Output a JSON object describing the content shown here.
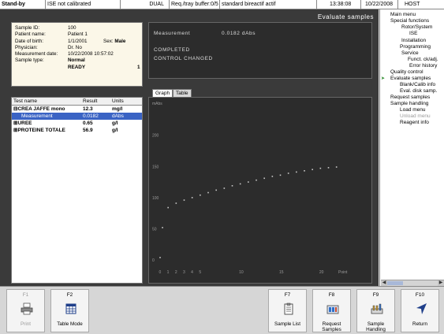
{
  "status_bar": {
    "state": "Stand-by",
    "ise_status": "ISE not calibrated",
    "mode": "DUAL",
    "tray_request": "Req./tray buffer:0/5",
    "bireactif": "standard bireactif actif",
    "time": "13:38:08",
    "date": "10/22/2008",
    "host": "HOST"
  },
  "screen_title": "Evaluate samples",
  "sample_info": {
    "sample_id_label": "Sample ID:",
    "sample_id": "100",
    "patient_name_label": "Patient name:",
    "patient_name": "Patient 1",
    "dob_label": "Date of birth:",
    "dob": "1/1/2001",
    "sex_label": "Sex:",
    "sex": "Male",
    "physician_label": "Physician:",
    "physician": "Dr. No",
    "meas_date_label": "Measurement date:",
    "meas_date": "10/22/2008 10:57:02",
    "sample_type_label": "Sample type:",
    "sample_type": "Normal",
    "state": "READY",
    "count": "1"
  },
  "results_table": {
    "headers": {
      "name": "Test name",
      "result": "Result",
      "units": "Units"
    },
    "rows": [
      {
        "name": "⊟CREA JAFFE mono",
        "result": "12.3",
        "units": "mg/l",
        "bold": true
      },
      {
        "name": "Measurement",
        "result": "0.0182",
        "units": "dAbs",
        "selected": true
      },
      {
        "name": "⊞UREE",
        "result": "0.65",
        "units": "g/l",
        "bold": true
      },
      {
        "name": "⊞PROTEINE TOTALE",
        "result": "56.9",
        "units": "g/l",
        "bold": true
      }
    ]
  },
  "measurement_panel": {
    "label": "Measurement",
    "value": "0.0182 dAbs",
    "line1": "COMPLETED",
    "line2": "CONTROL CHANGED"
  },
  "graph_tabs": {
    "graph": "Graph",
    "table": "Table"
  },
  "chart_data": {
    "type": "scatter",
    "ylabel": "mAbs",
    "xlabel": "Point",
    "x_tick_labels": [
      "0",
      "1",
      "2",
      "3",
      "4",
      "5",
      "10",
      "15",
      "20"
    ],
    "y_tick_labels": [
      "0",
      "50",
      "100",
      "150",
      "200"
    ],
    "xlim": [
      0,
      24
    ],
    "ylim": [
      -10,
      245
    ],
    "grid": false,
    "marker_color": "#c8c8c8",
    "points": [
      {
        "x": 0,
        "y": 4
      },
      {
        "x": 0.3,
        "y": 52
      },
      {
        "x": 1,
        "y": 84
      },
      {
        "x": 2,
        "y": 91
      },
      {
        "x": 3,
        "y": 96
      },
      {
        "x": 4,
        "y": 100
      },
      {
        "x": 5,
        "y": 104
      },
      {
        "x": 6,
        "y": 108
      },
      {
        "x": 7,
        "y": 112
      },
      {
        "x": 8,
        "y": 115
      },
      {
        "x": 9,
        "y": 119
      },
      {
        "x": 10,
        "y": 122
      },
      {
        "x": 11,
        "y": 125
      },
      {
        "x": 12,
        "y": 128
      },
      {
        "x": 13,
        "y": 131
      },
      {
        "x": 14,
        "y": 134
      },
      {
        "x": 15,
        "y": 136
      },
      {
        "x": 16,
        "y": 139
      },
      {
        "x": 17,
        "y": 141
      },
      {
        "x": 18,
        "y": 143
      },
      {
        "x": 19,
        "y": 145
      },
      {
        "x": 20,
        "y": 147
      },
      {
        "x": 21,
        "y": 148
      },
      {
        "x": 22,
        "y": 149
      }
    ]
  },
  "side_menu": {
    "items": [
      {
        "label": "Main menu"
      },
      {
        "label": "Special functions"
      },
      {
        "label": "Rotor/System"
      },
      {
        "label": "ISE"
      },
      {
        "label": "Installation"
      },
      {
        "label": "Programming"
      },
      {
        "label": "Service"
      },
      {
        "label": "Funct. ck/adj."
      },
      {
        "label": "Error history"
      },
      {
        "label": "Quality control"
      },
      {
        "label": "Evaluate samples",
        "active": true
      },
      {
        "label": "Blank/Calib info"
      },
      {
        "label": "Eval. disk samp."
      },
      {
        "label": "Request samples"
      },
      {
        "label": "Sample handling"
      },
      {
        "label": "Load menu"
      },
      {
        "label": "Unload menu",
        "disabled": true
      },
      {
        "label": "Reagent info"
      }
    ]
  },
  "function_keys": {
    "f1": {
      "key": "F1",
      "label": "Print",
      "icon": "printer-icon",
      "disabled": true
    },
    "f2": {
      "key": "F2",
      "label": "Table Mode",
      "icon": "table-icon"
    },
    "f7": {
      "key": "F7",
      "label": "Sample List",
      "icon": "clipboard-icon"
    },
    "f8": {
      "key": "F8",
      "label1": "Request",
      "label2": "Samples",
      "icon": "request-samples-icon"
    },
    "f9": {
      "key": "F9",
      "label1": "Sample",
      "label2": "Handling",
      "icon": "sample-handling-icon"
    },
    "f10": {
      "key": "F10",
      "label": "Return",
      "icon": "return-arrow-icon"
    }
  }
}
